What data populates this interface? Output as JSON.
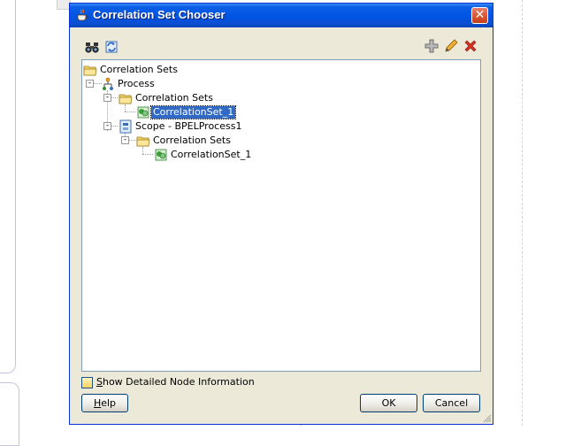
{
  "dialog": {
    "title": "Correlation Set Chooser",
    "close_glyph": "✕"
  },
  "toolbar": {
    "icons": [
      "binoculars-icon",
      "refresh-icon",
      "add-icon",
      "edit-icon",
      "delete-icon"
    ]
  },
  "tree": {
    "nodes": [
      {
        "label": "Correlation Sets",
        "icon": "folder-icon"
      },
      {
        "label": "Process",
        "icon": "process-icon"
      },
      {
        "label": "Correlation Sets",
        "icon": "folder-icon"
      },
      {
        "label": "CorrelationSet_1",
        "icon": "correlation-set-icon",
        "selected": true
      },
      {
        "label": "Scope - BPELProcess1",
        "icon": "scope-icon"
      },
      {
        "label": "Correlation Sets",
        "icon": "folder-icon"
      },
      {
        "label": "CorrelationSet_1",
        "icon": "correlation-set-icon"
      }
    ]
  },
  "footer": {
    "checkbox_label_mnemonic": "S",
    "checkbox_label_rest": "how Detailed Node Information",
    "checkbox_checked": false,
    "help_mnemonic": "H",
    "help_rest": "elp",
    "ok_label": "OK",
    "cancel_label": "Cancel"
  },
  "colors": {
    "titlebar": "#0054e3",
    "dialog_bg": "#ece9d8",
    "selection": "#316ac5",
    "close_button": "#d8522e"
  }
}
